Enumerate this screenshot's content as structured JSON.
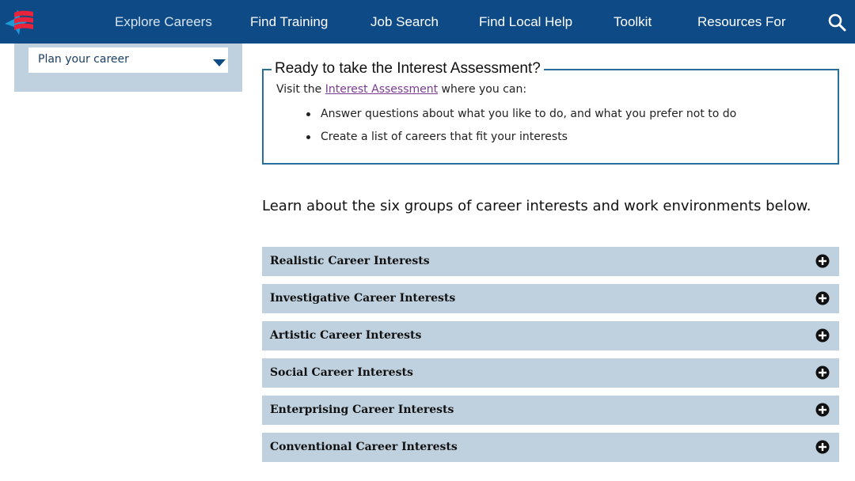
{
  "nav": {
    "items": [
      {
        "label": "Explore Careers",
        "active": true
      },
      {
        "label": "Find Training"
      },
      {
        "label": "Job Search"
      },
      {
        "label": "Find Local Help"
      },
      {
        "label": "Toolkit"
      },
      {
        "label": "Resources For"
      }
    ],
    "search_icon": "search-icon",
    "logo_icon": "careeronestop-logo"
  },
  "sidebar": {
    "select_value": "Plan your career"
  },
  "callout": {
    "title": "Ready to take the Interest Assessment?",
    "intro_before": "Visit the ",
    "intro_link": "Interest Assessment",
    "intro_after": " where you can:",
    "bullets": [
      "Answer questions about what you like to do, and what you prefer not to do",
      "Create a list of careers that fit your interests"
    ]
  },
  "main": {
    "learn_text": "Learn about the six groups of career interests and work environments below.",
    "accordions": [
      {
        "label": "Realistic Career Interests"
      },
      {
        "label": "Investigative Career Interests"
      },
      {
        "label": "Artistic Career Interests"
      },
      {
        "label": "Social Career Interests"
      },
      {
        "label": "Enterprising Career Interests"
      },
      {
        "label": "Conventional Career Interests"
      }
    ]
  },
  "colors": {
    "nav_bg": "#0d4a86",
    "panel_bg": "#bfd0de",
    "callout_border": "#2a6f9a",
    "link": "#7b3d8f",
    "logo_red": "#e8243c",
    "logo_blue": "#1d9ad6"
  }
}
